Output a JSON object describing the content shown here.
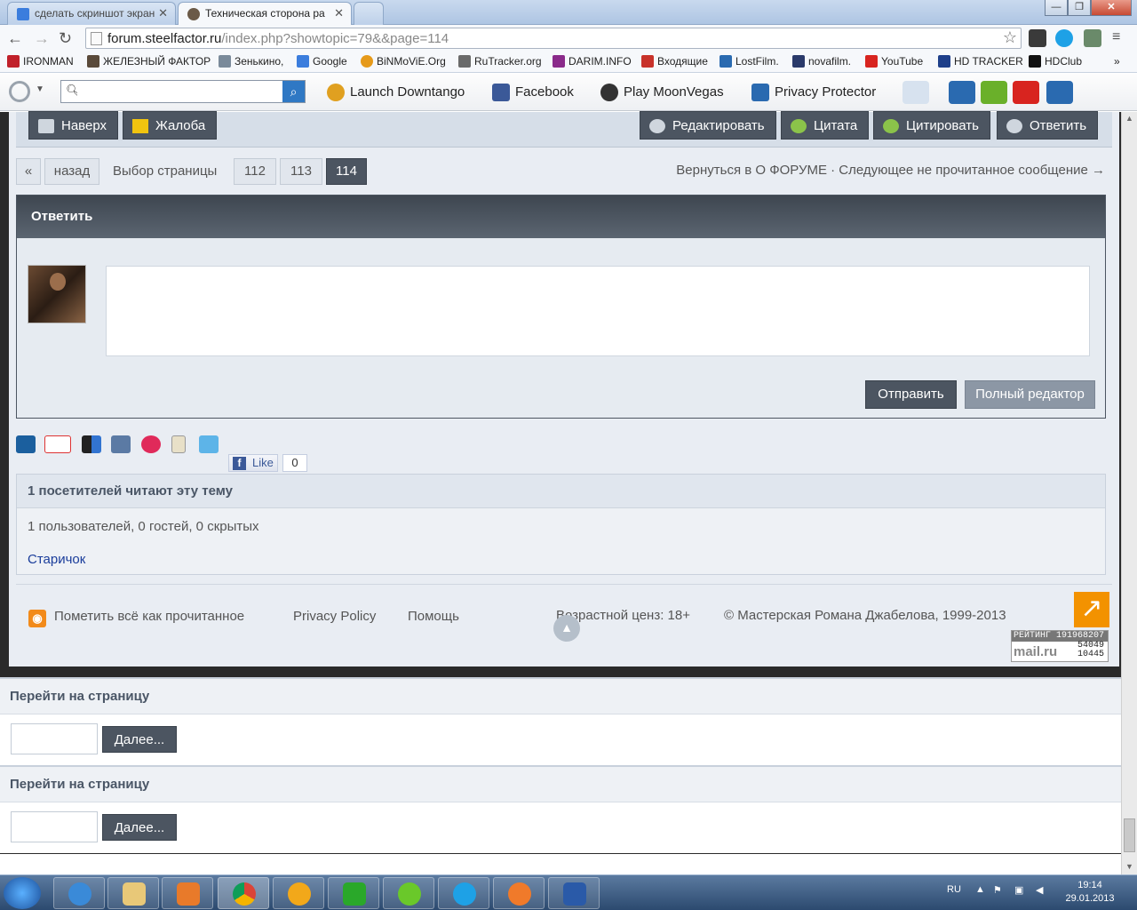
{
  "browser": {
    "tabs": [
      {
        "title": "сделать скриншот экран",
        "active": false,
        "icon": "google-icon"
      },
      {
        "title": "Техническая сторона ра",
        "active": true,
        "icon": "steelfactor-icon"
      }
    ],
    "url_host": "forum.steelfactor.ru",
    "url_path": "/index.php?showtopic=79&&page=114",
    "bookmarks": [
      {
        "label": "IRONMAN",
        "icon": "ironman-icon",
        "color": "#c0202a"
      },
      {
        "label": "ЖЕЛЕЗНЫЙ ФАКТОР",
        "icon": "steelfactor-icon",
        "color": "#5a4a3a"
      },
      {
        "label": "Зенькино,",
        "icon": "zenkino-icon",
        "color": "#7a8a9a"
      },
      {
        "label": "Google",
        "icon": "google-icon",
        "color": "#3b7ddd"
      },
      {
        "label": "BiNMoViE.Org",
        "icon": "binmovie-icon",
        "color": "#e69a1a"
      },
      {
        "label": "RuTracker.org",
        "icon": "rutracker-icon",
        "color": "#6a6a6a"
      },
      {
        "label": "DARIM.INFO",
        "icon": "heart-icon",
        "color": "#8a2a8a"
      },
      {
        "label": "Входящие",
        "icon": "gmail-icon",
        "color": "#c8322a"
      },
      {
        "label": "LostFilm.",
        "icon": "lostfilm-icon",
        "color": "#2a6ab0"
      },
      {
        "label": "novafilm.",
        "icon": "novafilm-icon",
        "color": "#2a3a6a"
      },
      {
        "label": "YouTube",
        "icon": "youtube-icon",
        "color": "#d8241f"
      },
      {
        "label": "HD TRACKER",
        "icon": "hdtracker-icon",
        "color": "#1e3f8a"
      },
      {
        "label": "HDClub",
        "icon": "hdclub-icon",
        "color": "#111111"
      }
    ]
  },
  "ext_toolbar": {
    "search_placeholder": "",
    "links": [
      {
        "label": "Launch Downtango",
        "icon": "downtango-icon",
        "color": "#e0a020"
      },
      {
        "label": "Facebook",
        "icon": "facebook-icon",
        "color": "#3b5998"
      },
      {
        "label": "Play MoonVegas",
        "icon": "moonvegas-icon",
        "color": "#333333"
      },
      {
        "label": "Privacy Protector",
        "icon": "privacy-icon",
        "color": "#2a6ab0"
      }
    ]
  },
  "post_actions": {
    "left": [
      "Наверх",
      "Жалоба"
    ],
    "right": [
      "Редактировать",
      "Цитата",
      "Цитировать",
      "Ответить"
    ]
  },
  "pagination": {
    "first": "«",
    "prev": "назад",
    "label": "Выбор страницы",
    "pages": [
      "112",
      "113",
      "114"
    ],
    "current": "114",
    "back_link": "Вернуться в О ФОРУМЕ · Следующее не прочитанное сообщение →"
  },
  "reply": {
    "title": "Ответить",
    "submit": "Отправить",
    "full_editor": "Полный редактор"
  },
  "social": {
    "icons": [
      "digg-icon",
      "gplus-icon",
      "delicious-icon",
      "vk-icon",
      "star-icon",
      "blog-icon",
      "twitter-icon"
    ],
    "like_label": "Like",
    "like_count": "0"
  },
  "viewers": {
    "title": "1 посетителей читают эту тему",
    "summary": "1 пользователей, 0 гостей, 0 скрытых",
    "user": "Старичок"
  },
  "footer": {
    "mark_read": "Пометить всё как прочитанное",
    "privacy": "Privacy Policy",
    "help": "Помощь",
    "age": "Возрастной ценз: 18+",
    "copyright": "© Мастерская Романа Джабелова, 1999-2013",
    "rating_label": "РЕЙТИНГ",
    "rating_value": "191968207",
    "rating_line2": "54049",
    "rating_line3": "10445",
    "rating_logo": "mail.ru"
  },
  "goto": [
    {
      "title": "Перейти на страницу",
      "button": "Далее..."
    },
    {
      "title": "Перейти на страницу",
      "button": "Далее..."
    }
  ],
  "taskbar": {
    "lang": "RU",
    "time": "19:14",
    "date": "29.01.2013",
    "apps": [
      "ie-icon",
      "explorer-icon",
      "media-player-icon",
      "chrome-icon",
      "aimp-icon",
      "utorrent-icon",
      "icq-icon",
      "skype-icon",
      "mail-icon",
      "word-icon"
    ]
  }
}
